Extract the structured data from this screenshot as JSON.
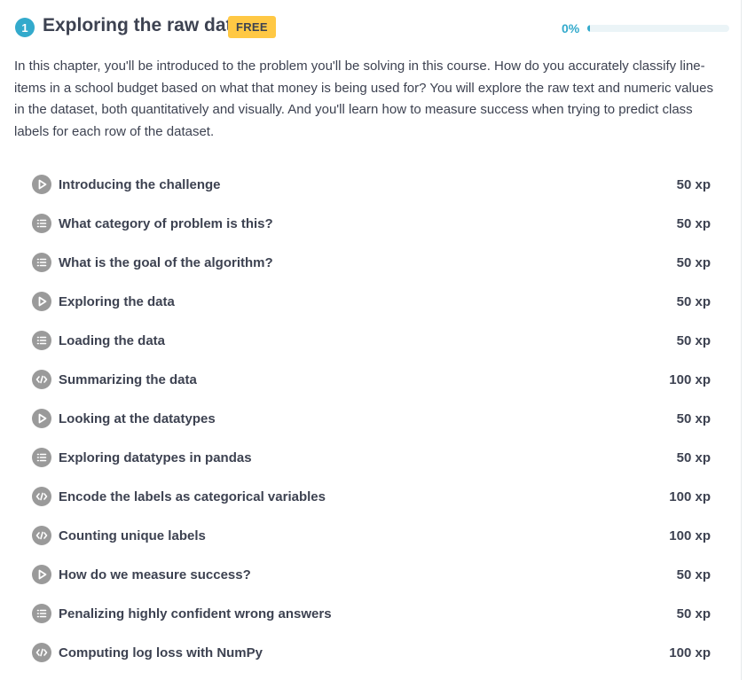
{
  "chapter": {
    "number": "1",
    "title": "Exploring the raw data",
    "badge": "FREE",
    "progress_label": "0%",
    "progress_fraction": 0,
    "description": "In this chapter, you'll be introduced to the problem you'll be solving in this course. How do you accurately classify line-items in a school budget based on what that money is being used for? You will explore the raw text and numeric values in the dataset, both quantitatively and visually. And you'll learn how to measure success when trying to predict class labels for each row of the dataset."
  },
  "colors": {
    "accent": "#33aacc",
    "badge": "#ffc844",
    "icon": "#9a9a9a",
    "text": "#3d4251"
  },
  "exercises": [
    {
      "title": "Introducing the challenge",
      "xp": "50 xp",
      "icon": "play-icon"
    },
    {
      "title": "What category of problem is this?",
      "xp": "50 xp",
      "icon": "list-icon"
    },
    {
      "title": "What is the goal of the algorithm?",
      "xp": "50 xp",
      "icon": "list-icon"
    },
    {
      "title": "Exploring the data",
      "xp": "50 xp",
      "icon": "play-icon"
    },
    {
      "title": "Loading the data",
      "xp": "50 xp",
      "icon": "list-icon"
    },
    {
      "title": "Summarizing the data",
      "xp": "100 xp",
      "icon": "code-icon"
    },
    {
      "title": "Looking at the datatypes",
      "xp": "50 xp",
      "icon": "play-icon"
    },
    {
      "title": "Exploring datatypes in pandas",
      "xp": "50 xp",
      "icon": "list-icon"
    },
    {
      "title": "Encode the labels as categorical variables",
      "xp": "100 xp",
      "icon": "code-icon"
    },
    {
      "title": "Counting unique labels",
      "xp": "100 xp",
      "icon": "code-icon"
    },
    {
      "title": "How do we measure success?",
      "xp": "50 xp",
      "icon": "play-icon"
    },
    {
      "title": "Penalizing highly confident wrong answers",
      "xp": "50 xp",
      "icon": "list-icon"
    },
    {
      "title": "Computing log loss with NumPy",
      "xp": "100 xp",
      "icon": "code-icon"
    }
  ]
}
